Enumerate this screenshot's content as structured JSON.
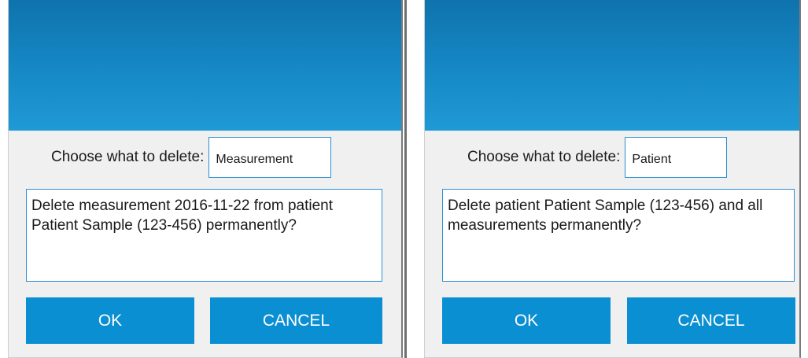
{
  "dialogs": [
    {
      "choose_label": "Choose what to delete:",
      "choose_value": "Measurement",
      "message": "Delete measurement 2016-11-22 from patient Patient Sample (123-456) permanently?",
      "ok_label": "OK",
      "cancel_label": "CANCEL"
    },
    {
      "choose_label": "Choose what to delete:",
      "choose_value": "Patient",
      "message": "Delete patient Patient Sample (123-456) and all measurements permanently?",
      "ok_label": "OK",
      "cancel_label": "CANCEL"
    }
  ],
  "colors": {
    "banner_top": "#0f73ad",
    "banner_bottom": "#1f9ad6",
    "button": "#0a8fd3",
    "field_border": "#2a8fd1",
    "dialog_bg": "#f0f0f0"
  }
}
